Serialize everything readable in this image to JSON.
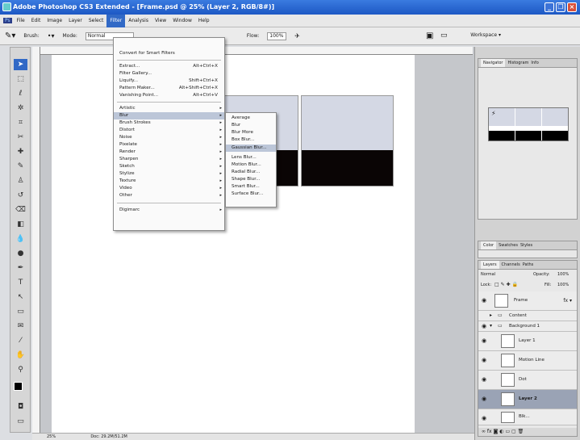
{
  "window": {
    "title": "Adobe Photoshop CS3 Extended - [Frame.psd @ 25% (Layer 2, RGB/8#)]"
  },
  "menubar": {
    "items": [
      "File",
      "Edit",
      "Image",
      "Layer",
      "Select",
      "Filter",
      "Analysis",
      "View",
      "Window",
      "Help"
    ],
    "active": "Filter"
  },
  "options": {
    "brush_label": "Brush:",
    "mode_label": "Mode:",
    "mode_value": "Normal",
    "flow_label": "Flow:",
    "flow_value": "100%",
    "workspace_label": "Workspace ▾"
  },
  "filter_menu": {
    "items": [
      {
        "label": "Convert for Smart Filters",
        "shortcut": ""
      },
      {
        "label": "Extract...",
        "shortcut": "Alt+Ctrl+X"
      },
      {
        "label": "Filter Gallery...",
        "shortcut": ""
      },
      {
        "label": "Liquify...",
        "shortcut": "Shift+Ctrl+X"
      },
      {
        "label": "Pattern Maker...",
        "shortcut": "Alt+Shift+Ctrl+X"
      },
      {
        "label": "Vanishing Point...",
        "shortcut": "Alt+Ctrl+V"
      },
      {
        "label": "Artistic",
        "shortcut": ""
      },
      {
        "label": "Blur",
        "shortcut": ""
      },
      {
        "label": "Brush Strokes",
        "shortcut": ""
      },
      {
        "label": "Distort",
        "shortcut": ""
      },
      {
        "label": "Noise",
        "shortcut": ""
      },
      {
        "label": "Pixelate",
        "shortcut": ""
      },
      {
        "label": "Render",
        "shortcut": ""
      },
      {
        "label": "Sharpen",
        "shortcut": ""
      },
      {
        "label": "Sketch",
        "shortcut": ""
      },
      {
        "label": "Stylize",
        "shortcut": ""
      },
      {
        "label": "Texture",
        "shortcut": ""
      },
      {
        "label": "Video",
        "shortcut": ""
      },
      {
        "label": "Other",
        "shortcut": ""
      },
      {
        "label": "Digimarc",
        "shortcut": ""
      }
    ]
  },
  "blur_submenu": {
    "items": [
      "Average",
      "Blur",
      "Blur More",
      "Box Blur...",
      "Gaussian Blur...",
      "Lens Blur...",
      "Motion Blur...",
      "Radial Blur...",
      "Shape Blur...",
      "Smart Blur...",
      "Surface Blur..."
    ],
    "highlighted": "Gaussian Blur..."
  },
  "navigator": {
    "tabs": [
      "Navigator",
      "Histogram",
      "Info"
    ]
  },
  "color_panel": {
    "tabs": [
      "Color",
      "Swatches",
      "Styles"
    ]
  },
  "layers_panel": {
    "tabs": [
      "Layers",
      "Channels",
      "Paths"
    ],
    "blend_mode": "Normal",
    "opacity_label": "Opacity:",
    "opacity_value": "100%",
    "lock_label": "Lock:",
    "fill_label": "Fill:",
    "fill_value": "100%",
    "items": [
      {
        "name": "Frame"
      },
      {
        "name": "Content"
      },
      {
        "name": "Background 1"
      },
      {
        "name": "Layer 1"
      },
      {
        "name": "Motion Line"
      },
      {
        "name": "Dot"
      },
      {
        "name": "Layer 2"
      },
      {
        "name": "Blk..."
      }
    ]
  },
  "status": {
    "zoom": "25%",
    "doc": "Doc: 29.2M/51.2M"
  }
}
